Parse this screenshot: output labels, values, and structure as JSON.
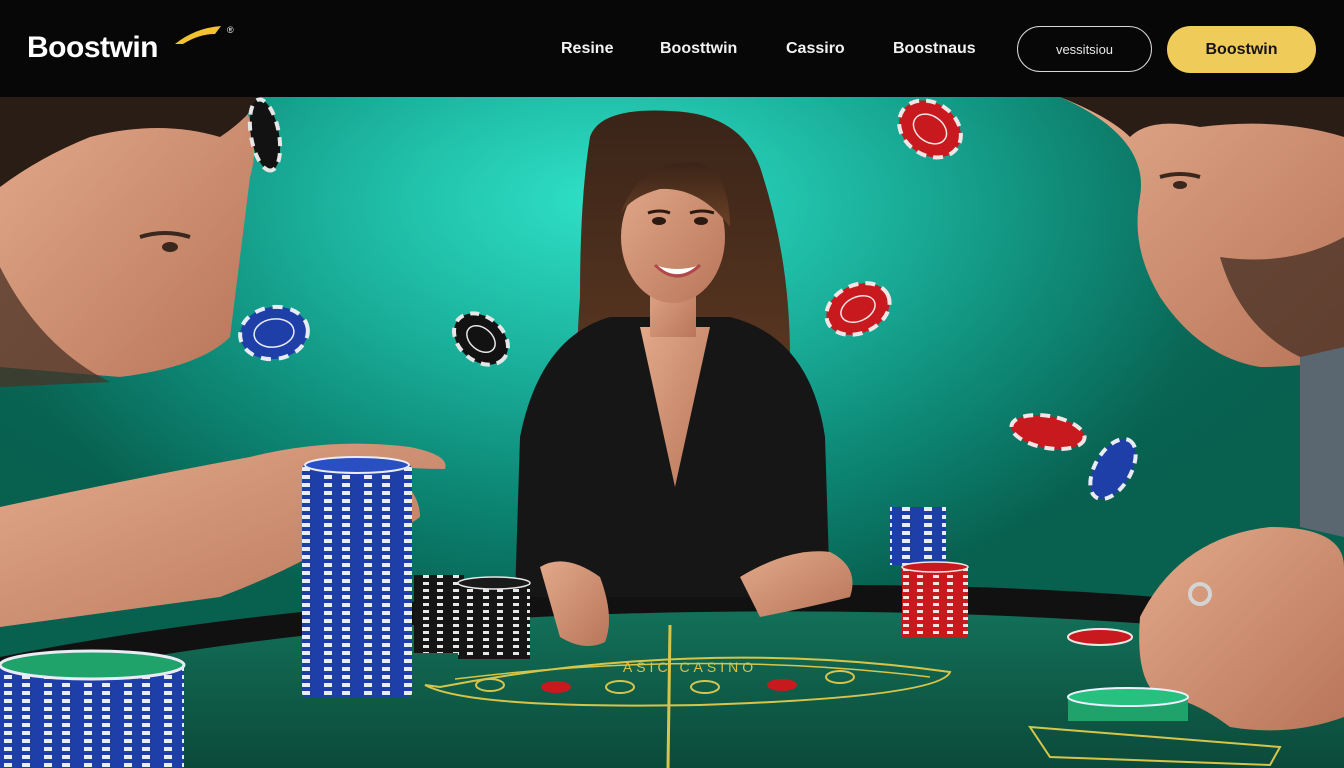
{
  "header": {
    "logo_text": "Boostwin",
    "logo_reg": "®",
    "nav": [
      {
        "label": "Resine"
      },
      {
        "label": "Boosttwin"
      },
      {
        "label": "Cassiro"
      },
      {
        "label": "Boostnaus"
      }
    ],
    "outline_button_label": "vessitsiou",
    "primary_button_label": "Boostwin"
  },
  "hero": {
    "table_print_text": "ASIC CASINO",
    "colors": {
      "backdrop": "#15b29d",
      "felt": "#0f5a47",
      "gold_button": "#efcb5a",
      "chip_blue": "#1f3fa8",
      "chip_red": "#c8191f",
      "chip_black": "#111111",
      "chip_green": "#1fa36a"
    }
  }
}
